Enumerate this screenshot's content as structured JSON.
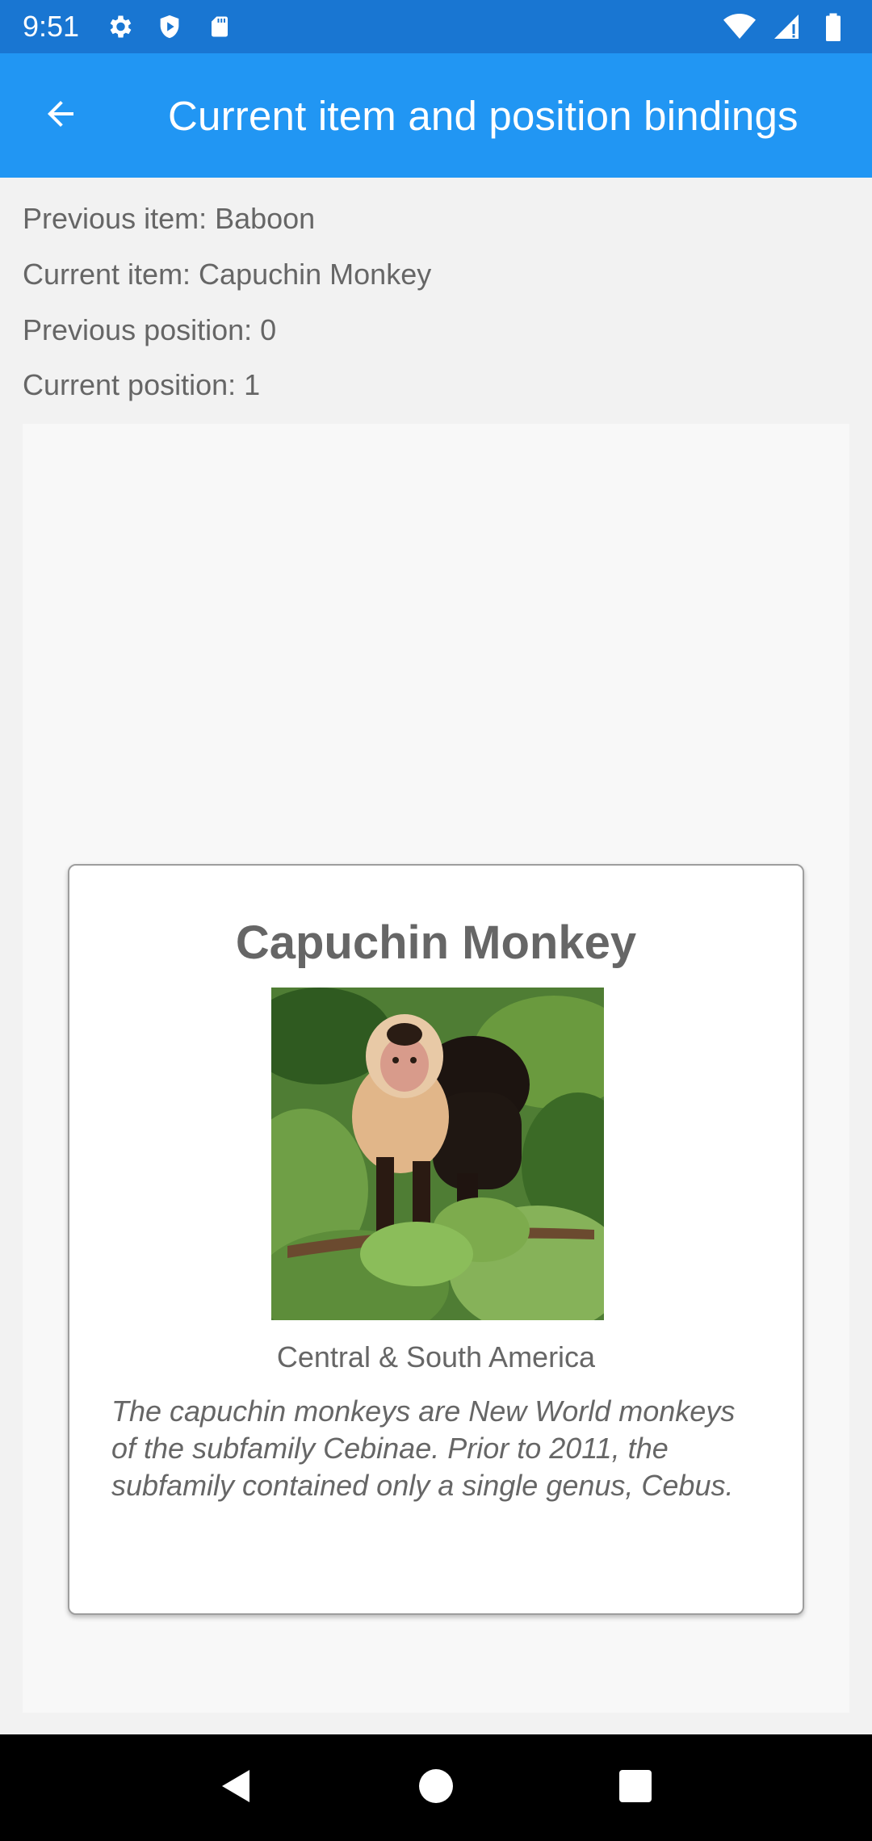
{
  "status_bar": {
    "time": "9:51",
    "left_icons": [
      "gear-icon",
      "shield-play-icon",
      "sd-card-icon"
    ],
    "right_icons": [
      "wifi-icon",
      "signal-icon",
      "battery-icon"
    ]
  },
  "app_bar": {
    "back_icon": "arrow-left-icon",
    "title": "Current item and position bindings"
  },
  "bindings": {
    "previous_item": "Previous item: Baboon",
    "current_item": "Current item: Capuchin Monkey",
    "previous_position": "Previous position: 0",
    "current_position": "Current position: 1"
  },
  "card": {
    "title": "Capuchin Monkey",
    "location": "Central & South America",
    "details": "The capuchin monkeys are New World monkeys of the subfamily Cebinae. Prior to 2011, the subfamily contained only a single genus, Cebus."
  },
  "nav_bar": {
    "buttons": [
      "back-triangle-icon",
      "home-circle-icon",
      "recents-square-icon"
    ]
  },
  "colors": {
    "status_bar": "#1976D2",
    "app_bar": "#2196F3",
    "text_secondary": "#666666"
  }
}
